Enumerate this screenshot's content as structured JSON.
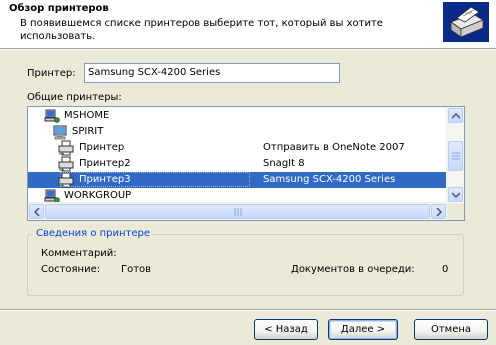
{
  "header": {
    "title": "Обзор принтеров",
    "subtitle": "В появившемся списке принтеров выберите тот, который вы хотите использовать."
  },
  "printer_field": {
    "label": "Принтер:",
    "value": "Samsung SCX-4200 Series"
  },
  "shared_printers": {
    "label": "Общие принтеры:",
    "items": [
      {
        "name": "MSHOME",
        "comment": "",
        "icon": "network-group-icon"
      },
      {
        "name": "SPIRIT",
        "comment": "",
        "icon": "computer-icon"
      },
      {
        "name": "Принтер",
        "comment": "Отправить в OneNote 2007",
        "icon": "printer-icon"
      },
      {
        "name": "Принтер2",
        "comment": "SnagIt 8",
        "icon": "printer-icon"
      },
      {
        "name": "Принтер3",
        "comment": "Samsung SCX-4200 Series",
        "icon": "printer-icon",
        "selected": true
      },
      {
        "name": "WORKGROUP",
        "comment": "",
        "icon": "network-group-icon"
      }
    ]
  },
  "printer_info": {
    "title": "Сведения о принтере",
    "comment_label": "Комментарий:",
    "comment_value": "",
    "status_label": "Состояние:",
    "status_value": "Готов",
    "queue_label": "Документов в очереди:",
    "queue_value": "0"
  },
  "buttons": {
    "back": "< Назад",
    "next": "Далее >",
    "cancel": "Отмена"
  },
  "colors": {
    "selection": "#316ac5",
    "group_title": "#0046d5",
    "background": "#ece9d8"
  }
}
